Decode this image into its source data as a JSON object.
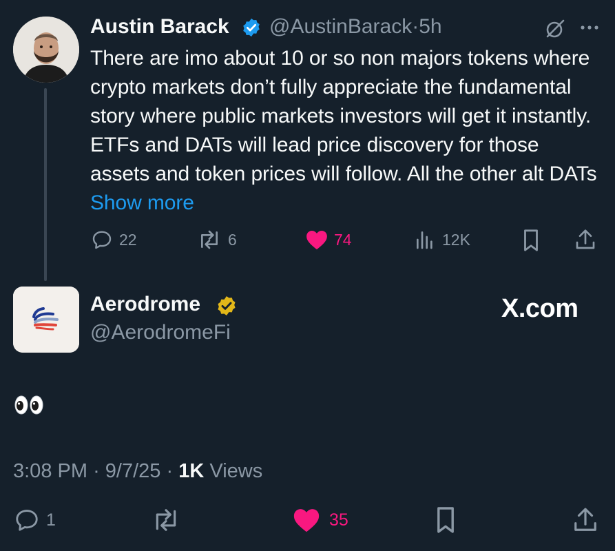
{
  "tweet": {
    "author_name": "Austin Barack",
    "handle": "@AustinBarack",
    "separator": "·",
    "time_ago": "5h",
    "body_text": "There are imo about 10 or so non majors tokens where crypto markets don’t fully appreciate the fundamental story where public markets investors will get it instantly. ETFs and DATs will lead price discovery for those assets and token prices will follow. All the other alt DATs ",
    "show_more": "Show more",
    "replies": "22",
    "reposts": "6",
    "likes": "74",
    "views": "12K",
    "like_color": "#f91880",
    "link_color": "#1d9bf0"
  },
  "reply": {
    "author_name": "Aerodrome",
    "handle": "@AerodromeFi",
    "watermark": "X.com",
    "body_emoji": "👀",
    "time": "3:08 PM",
    "date": "9/7/25",
    "separator": "·",
    "view_count": "1K",
    "views_label": "Views",
    "replies": "1",
    "likes": "35",
    "verified_badge_color": "#e2b719"
  },
  "icons": [
    "verified-badge-icon",
    "grok-icon",
    "more-icon",
    "reply-icon",
    "repost-icon",
    "heart-icon",
    "views-icon",
    "bookmark-icon",
    "share-icon",
    "eyes-emoji-icon"
  ]
}
